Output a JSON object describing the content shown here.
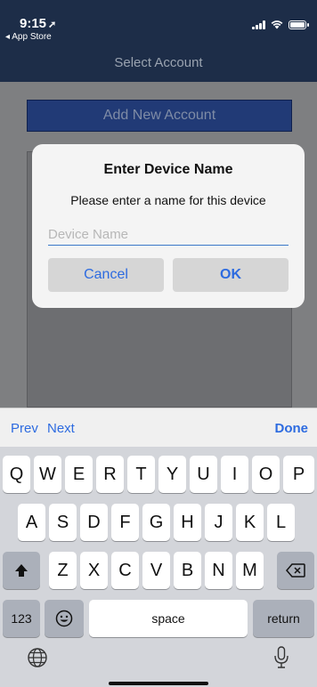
{
  "status_bar": {
    "time": "9:15",
    "back_app": "◂ App Store"
  },
  "nav": {
    "title": "Select Account"
  },
  "main": {
    "add_account_label": "Add New Account"
  },
  "dialog": {
    "title": "Enter Device Name",
    "message": "Please enter a name for this device",
    "input_placeholder": "Device Name",
    "input_value": "",
    "cancel_label": "Cancel",
    "ok_label": "OK"
  },
  "keyboard_accessory": {
    "prev_label": "Prev",
    "next_label": "Next",
    "done_label": "Done"
  },
  "keyboard": {
    "row1": [
      "Q",
      "W",
      "E",
      "R",
      "T",
      "Y",
      "U",
      "I",
      "O",
      "P"
    ],
    "row2": [
      "A",
      "S",
      "D",
      "F",
      "G",
      "H",
      "J",
      "K",
      "L"
    ],
    "row3": [
      "Z",
      "X",
      "C",
      "V",
      "B",
      "N",
      "M"
    ],
    "numbers_label": "123",
    "space_label": "space",
    "return_label": "return"
  },
  "icons": {
    "shift": "shift-icon",
    "delete": "backspace-icon",
    "emoji": "emoji-icon",
    "globe": "globe-icon",
    "mic": "microphone-icon"
  },
  "colors": {
    "nav_bar": "#1d2d48",
    "accent": "#2d6be0",
    "keyboard_bg": "#d3d5da"
  }
}
